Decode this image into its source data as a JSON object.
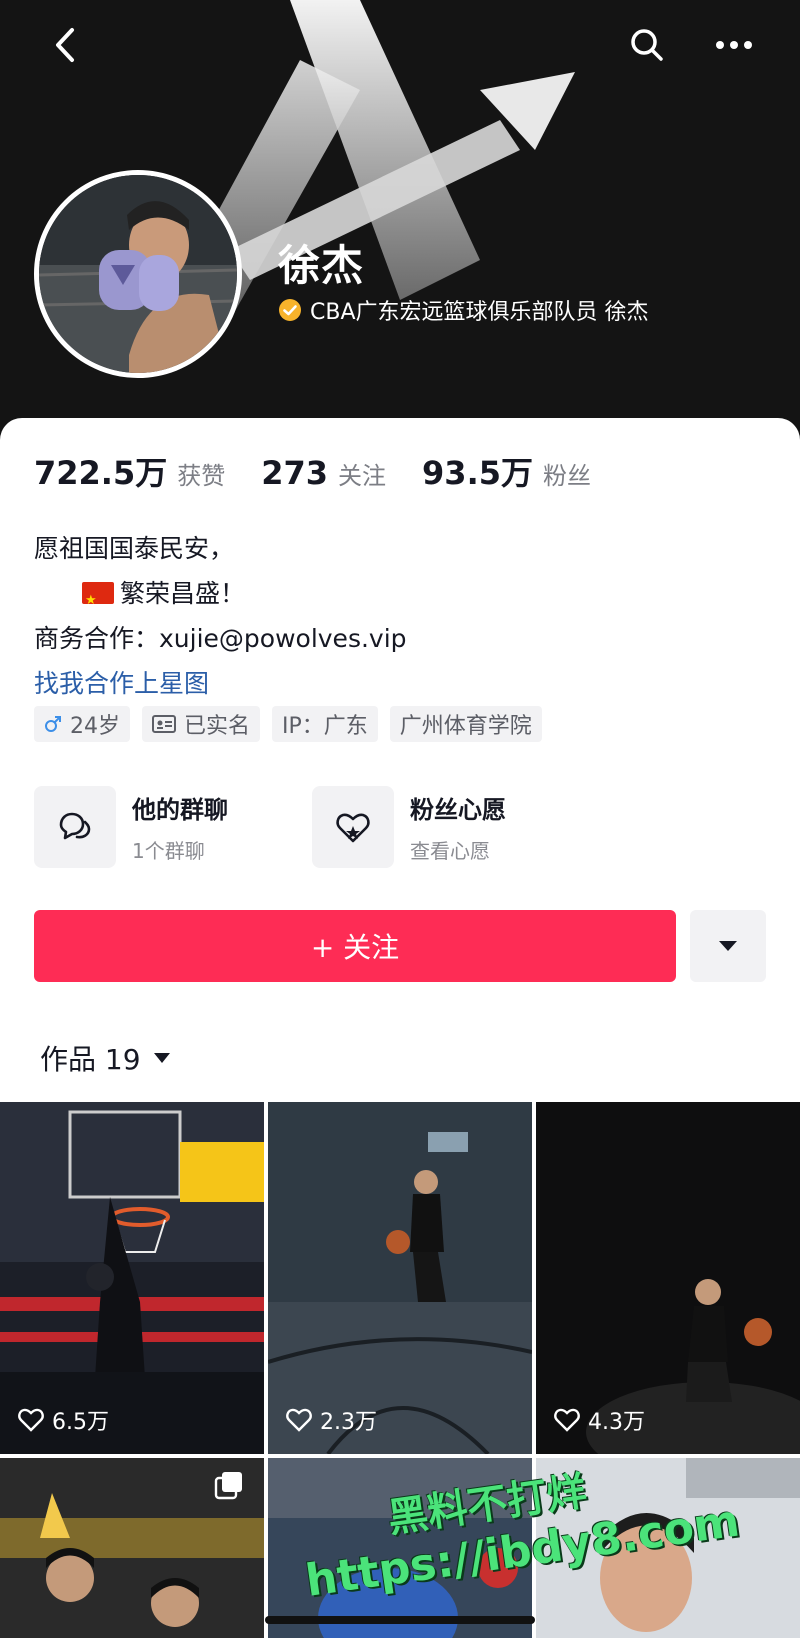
{
  "header": {
    "back_icon": "chevron-left-icon",
    "search_icon": "search-icon",
    "more_icon": "more-horizontal-icon"
  },
  "profile": {
    "name": "徐杰",
    "verified_text": "CBA广东宏远篮球俱乐部队员 徐杰",
    "verified_color": "#f7b32b"
  },
  "stats": [
    {
      "value": "722.5万",
      "label": "获赞"
    },
    {
      "value": "273",
      "label": "关注"
    },
    {
      "value": "93.5万",
      "label": "粉丝"
    }
  ],
  "bio": {
    "line1": "愿祖国国泰民安，",
    "line2": "繁荣昌盛！",
    "line3": "商务合作：xujie@powolves.vip",
    "link": "找我合作上星图"
  },
  "tags": {
    "age": "24岁",
    "realname": "已实名",
    "ip": "IP：广东",
    "school": "广州体育学院"
  },
  "entries": [
    {
      "title": "他的群聊",
      "subtitle": "1个群聊",
      "icon": "chat-bubbles-icon"
    },
    {
      "title": "粉丝心愿",
      "subtitle": "查看心愿",
      "icon": "heart-wish-icon"
    }
  ],
  "actions": {
    "follow_label": "+ 关注",
    "follow_color": "#fe2c55"
  },
  "works": {
    "tab_label": "作品 19"
  },
  "videos": [
    {
      "likes": "6.5万"
    },
    {
      "likes": "2.3万"
    },
    {
      "likes": "4.3万"
    }
  ],
  "watermark": {
    "line1": "黑料不打烊",
    "line2": "https://ibdy8.com"
  }
}
